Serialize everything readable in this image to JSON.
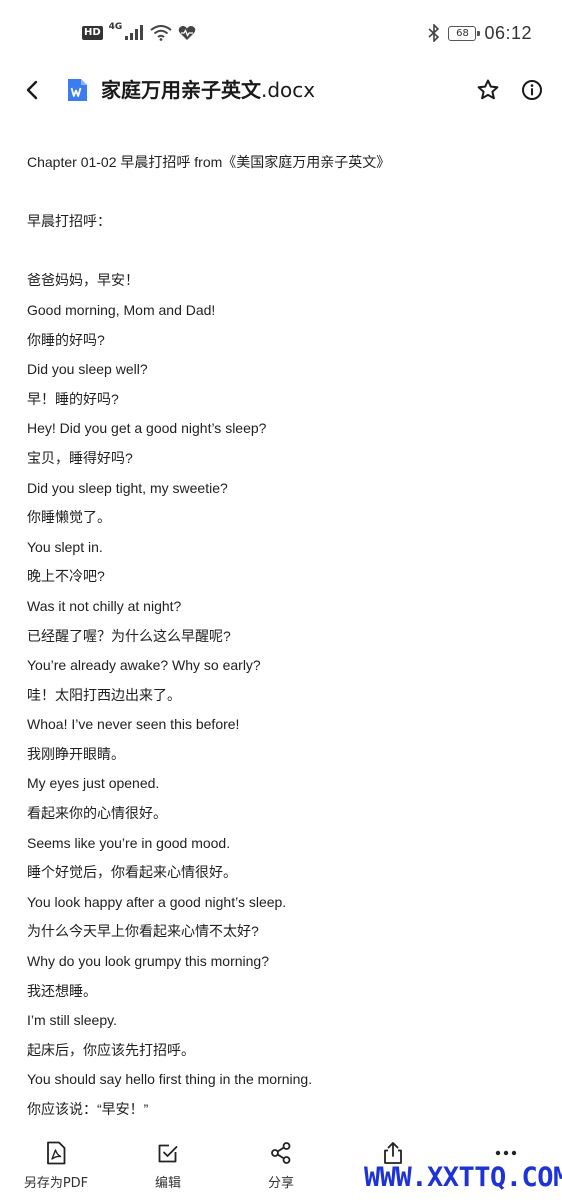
{
  "status_bar": {
    "hd": "HD",
    "network": "4G",
    "battery": "68",
    "time": "06:12",
    "icons": [
      "hd-icon",
      "signal-icon",
      "wifi-icon",
      "heart-icon",
      "bluetooth-icon",
      "battery-icon"
    ]
  },
  "title_bar": {
    "title": "家庭万用亲子英文",
    "extension": ".docx",
    "icons": [
      "back-arrow-icon",
      "word-doc-icon",
      "star-icon",
      "info-icon"
    ],
    "doc_icon_color": "#3b7cf0"
  },
  "document": {
    "heading": "Chapter 01-02 早晨打招呼 from《美国家庭万用亲子英文》",
    "section_title": "早晨打招呼：",
    "lines": [
      "爸爸妈妈，早安！",
      "Good morning, Mom and Dad!",
      "你睡的好吗?",
      "Did you sleep well?",
      "早！睡的好吗?",
      "Hey! Did you get a good night’s sleep?",
      "宝贝，睡得好吗?",
      "Did you sleep tight, my sweetie?",
      "你睡懒觉了。",
      "You slept in.",
      "晚上不冷吧?",
      "Was it not chilly at night?",
      "已经醒了喔？为什么这么早醒呢?",
      "You’re already awake? Why so early?",
      "哇！太阳打西边出来了。",
      "Whoa! I’ve never seen this before!",
      "我刚睁开眼睛。",
      "My eyes just opened.",
      "看起来你的心情很好。",
      "Seems like you’re in good mood.",
      "睡个好觉后，你看起来心情很好。",
      "You look happy after a good night’s sleep.",
      "为什么今天早上你看起来心情不太好?",
      "Why do you look grumpy this morning?",
      "我还想睡。",
      "I’m still sleepy.",
      "起床后，你应该先打招呼。",
      "You should say hello first thing in the morning.",
      "你应该说：“早安！”"
    ]
  },
  "toolbar": {
    "save_pdf": "另存为PDF",
    "edit": "编辑",
    "share": "分享",
    "icons": [
      "pdf-icon",
      "edit-icon",
      "share-icon",
      "open-with-icon",
      "more-icon"
    ]
  },
  "watermark": "WWW.XXTTQ.COM"
}
